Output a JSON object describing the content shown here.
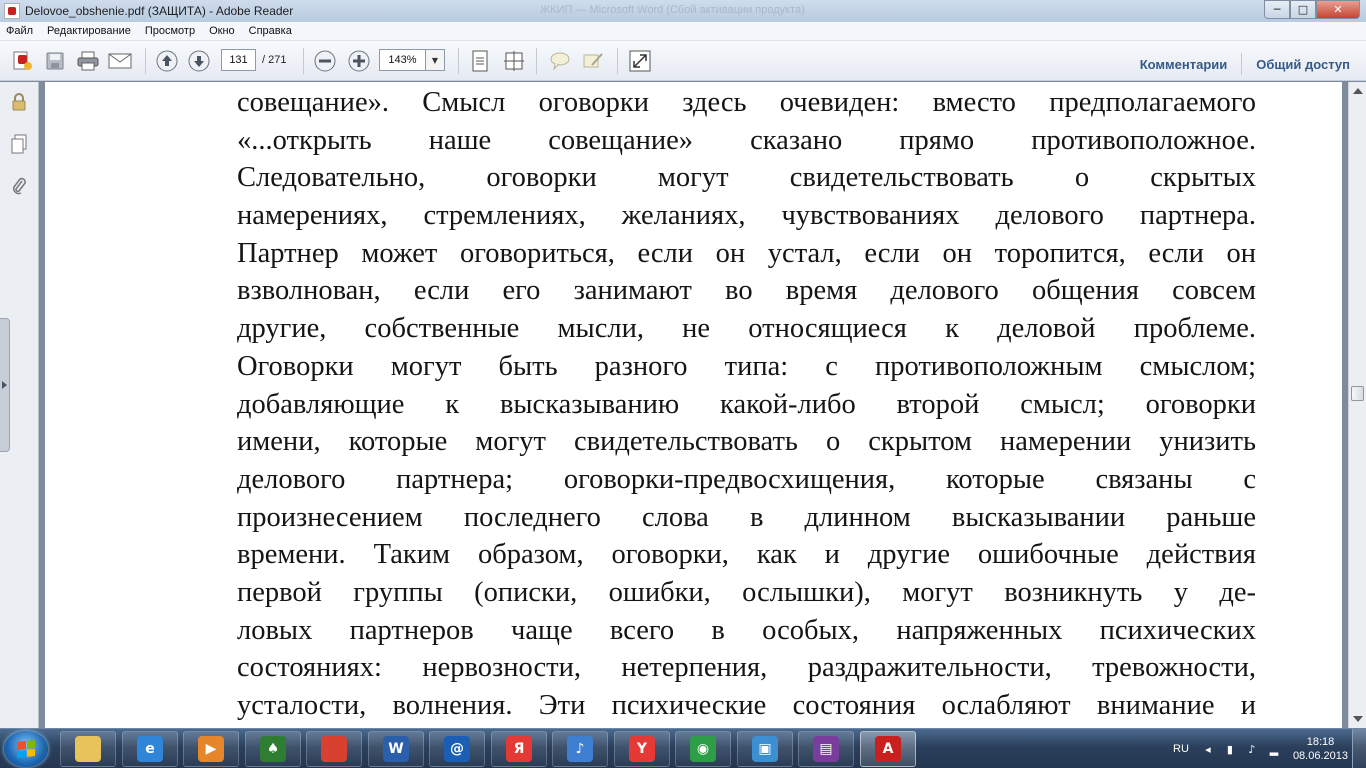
{
  "window": {
    "title": "Delovoe_obshenie.pdf (ЗАЩИТА) - Adobe Reader",
    "background_title": "ЖКИП — Microsoft Word (Сбой активации продукта)",
    "buttons": {
      "minimize": "─",
      "maximize": "□",
      "close": "✕"
    }
  },
  "menu": {
    "items": [
      "Файл",
      "Редактирование",
      "Просмотр",
      "Окно",
      "Справка"
    ]
  },
  "toolbar": {
    "page_current": "131",
    "page_total": "/ 271",
    "zoom": "143%",
    "comments_label": "Комментарии",
    "share_label": "Общий доступ",
    "icons": [
      "create-icon",
      "save-icon",
      "print-icon",
      "email-icon",
      "prev-page-icon",
      "next-page-icon",
      "zoom-out-icon",
      "zoom-in-icon",
      "fit-page-icon",
      "fit-width-icon",
      "comment-icon",
      "sign-icon",
      "fullscreen-icon"
    ]
  },
  "nav_pane": {
    "icons": [
      "lock-icon",
      "pages-icon",
      "attachment-icon"
    ]
  },
  "document": {
    "lines": [
      "совещание». Смысл оговорки здесь очевиден: вместо предполагаемого",
      "«...открыть наше совещание» сказано прямо противоположное.",
      "Следовательно, оговорки могут свидетельствовать о скрытых",
      "намерениях, стремлениях, желаниях, чувствованиях делового партнера.",
      "Партнер может оговориться, если он устал, если он торопится, если он",
      "взволнован, если его занимают во время делового общения совсем",
      "другие, собственные мысли, не относящиеся к деловой проблеме.",
      "Оговорки могут быть разного типа: с противоположным смыслом;",
      "добавляющие к высказыванию какой-либо второй смысл; оговорки",
      "имени, которые могут свидетельствовать о скрытом намерении унизить",
      "делового партнера; оговорки-предвосхищения, которые связаны с",
      "произнесением последнего слова в длинном высказывании раньше",
      "времени. Таким образом, оговорки, как и другие ошибочные действия",
      "первой группы (описки, ошибки, ослышки), могут возникнуть у де-",
      "ловых партнеров чаще всего в особых, напряженных психических",
      "состояниях: нервозности, нетерпения, раздражительности, тревожности,",
      "усталости, волнения. Эти психические состояния ослабляют внимание и"
    ]
  },
  "taskbar": {
    "apps": [
      {
        "name": "explorer",
        "glyph": "",
        "color": "#e8c25a"
      },
      {
        "name": "internet-explorer",
        "glyph": "e",
        "color": "#2f86d8"
      },
      {
        "name": "media-player",
        "glyph": "▶",
        "color": "#e6862b"
      },
      {
        "name": "solitaire",
        "glyph": "♠",
        "color": "#2e7d32"
      },
      {
        "name": "chrome",
        "glyph": "",
        "color": "#d8412f"
      },
      {
        "name": "word",
        "glyph": "W",
        "color": "#2b5faa"
      },
      {
        "name": "mail-agent",
        "glyph": "@",
        "color": "#1a5fb4"
      },
      {
        "name": "yandex",
        "glyph": "Я",
        "color": "#e53935"
      },
      {
        "name": "sound",
        "glyph": "♪",
        "color": "#3f7fd1"
      },
      {
        "name": "yandex-browser",
        "glyph": "Y",
        "color": "#e53935"
      },
      {
        "name": "network",
        "glyph": "◉",
        "color": "#2e9d48"
      },
      {
        "name": "image-viewer",
        "glyph": "▣",
        "color": "#3c8fd0"
      },
      {
        "name": "winrar",
        "glyph": "▤",
        "color": "#7b3d9b"
      },
      {
        "name": "adobe-reader",
        "glyph": "A",
        "color": "#c8201e"
      }
    ],
    "language": "RU",
    "time": "18:18",
    "date": "08.06.2013"
  }
}
